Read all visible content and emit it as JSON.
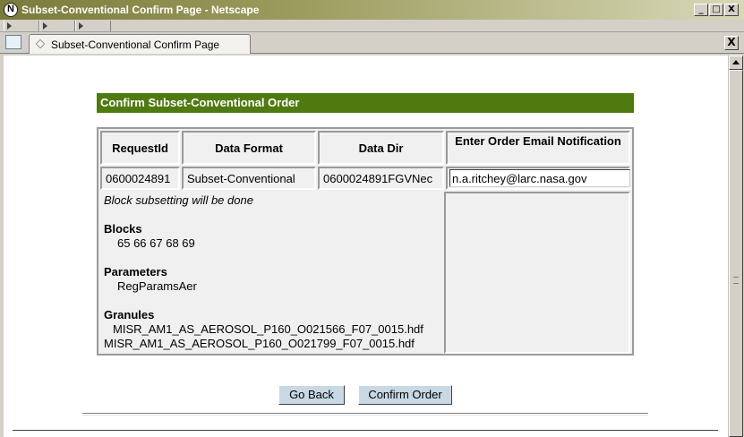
{
  "window": {
    "title": "Subset-Conventional Confirm Page - Netscape",
    "minimize_glyph": "_",
    "maximize_glyph": "□",
    "close_glyph": "X"
  },
  "tab": {
    "label": "Subset-Conventional Confirm Page",
    "close_glyph": "X"
  },
  "page": {
    "header": "Confirm Subset-Conventional Order",
    "table": {
      "columns": [
        "RequestId",
        "Data Format",
        "Data Dir",
        "Enter Order Email Notification"
      ],
      "row": {
        "request_id": "0600024891",
        "data_format": "Subset-Conventional",
        "data_dir": "0600024891FGVNec"
      },
      "email_value": "n.a.ritchey@larc.nasa.gov"
    },
    "details": {
      "note": "Block subsetting will be done",
      "blocks_label": "Blocks",
      "blocks": "65 66 67 68 69",
      "parameters_label": "Parameters",
      "parameters": "RegParamsAer",
      "granules_label": "Granules",
      "granules": [
        "MISR_AM1_AS_AEROSOL_P160_O021566_F07_0015.hdf",
        "MISR_AM1_AS_AEROSOL_P160_O021799_F07_0015.hdf"
      ]
    },
    "buttons": {
      "back": "Go Back",
      "confirm": "Confirm Order"
    }
  },
  "colors": {
    "header_bg": "#4f7a10",
    "button_bg": "#c8d8e4"
  }
}
